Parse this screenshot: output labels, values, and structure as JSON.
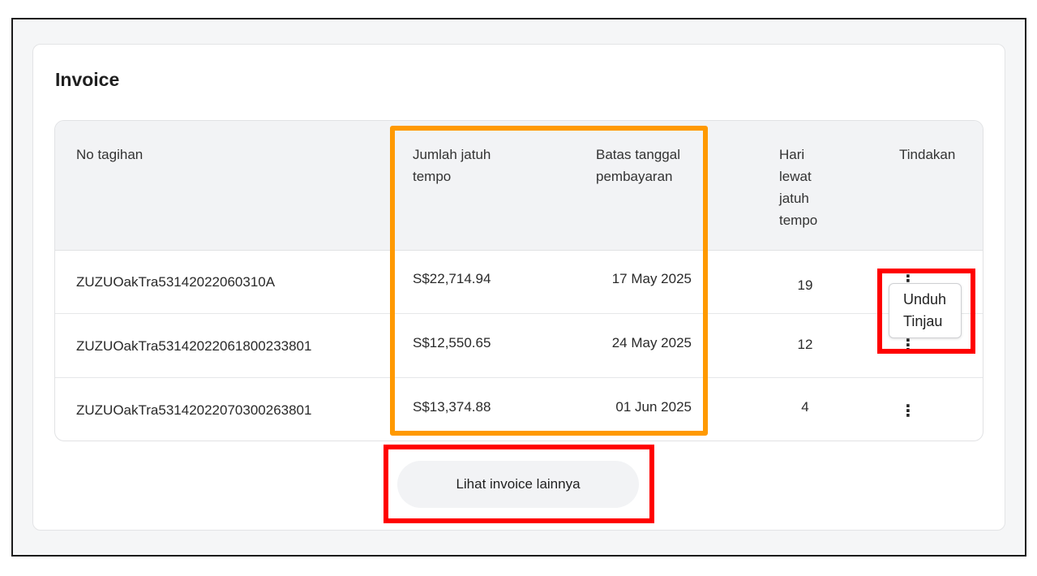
{
  "card": {
    "title": "Invoice"
  },
  "table": {
    "headers": {
      "no": "No tagihan",
      "amount": "Jumlah jatuh tempo",
      "due_date": "Batas tanggal pembayaran",
      "days_overdue": "Hari lewat jatuh tempo",
      "actions": "Tindakan"
    },
    "rows": [
      {
        "no": "ZUZUOakTra53142022060310A",
        "amount": "S$22,714.94",
        "due_date": "17 May 2025",
        "days": "19"
      },
      {
        "no": "ZUZUOakTra5314202206180023380 1",
        "amount": "S$12,550.65",
        "due_date": "24 May 2025",
        "days": "12"
      },
      {
        "no": "ZUZUOakTra53142022070300263801",
        "amount": "S$13,374.88",
        "due_date": "01 Jun 2025",
        "days": "4"
      }
    ]
  },
  "action_menu": {
    "download": "Unduh",
    "review": "Tinjau"
  },
  "more_button": {
    "label": "Lihat invoice lainnya"
  },
  "icons": {
    "row_menu": "kebab-vertical-icon"
  },
  "colors": {
    "highlight_orange": "#ff9900",
    "highlight_red": "#ff0000"
  }
}
